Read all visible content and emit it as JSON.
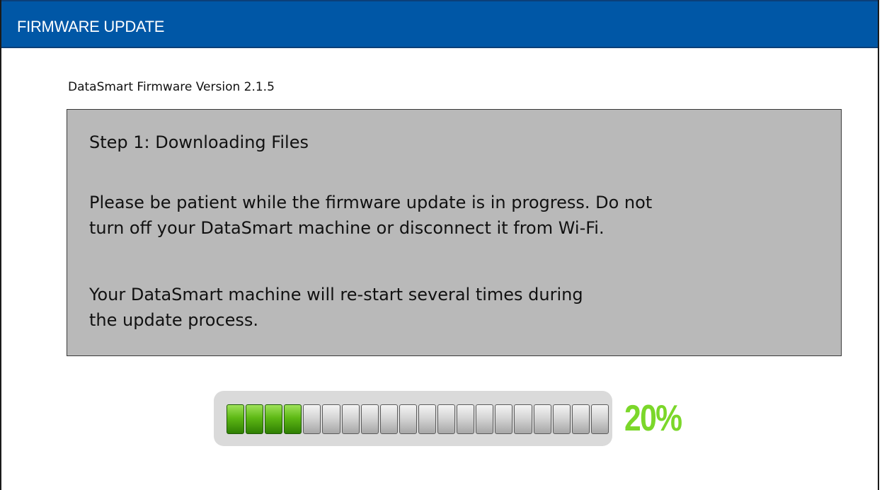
{
  "window": {
    "title": "FIRMWARE UPDATE"
  },
  "header": {
    "version_label": "DataSmart Firmware Version 2.1.5"
  },
  "status_box": {
    "heading": "Step 1: Downloading Files",
    "paragraph_1_lines": [
      "Please be patient while the firmware update is in progress. Do not",
      "turn off your DataSmart machine or disconnect it from Wi-Fi."
    ],
    "paragraph_2_lines": [
      "Your DataSmart machine will re-start several times during",
      "the update process."
    ]
  },
  "progress": {
    "percent_label": "20%",
    "fraction": 0.2,
    "total_segments": 20,
    "filled_segments": 4
  },
  "colors": {
    "title_bar": "#0057a6",
    "status_box_bg": "#b9b9b9",
    "progress_fill": "#5eb915",
    "progress_text": "#7bd72a"
  }
}
